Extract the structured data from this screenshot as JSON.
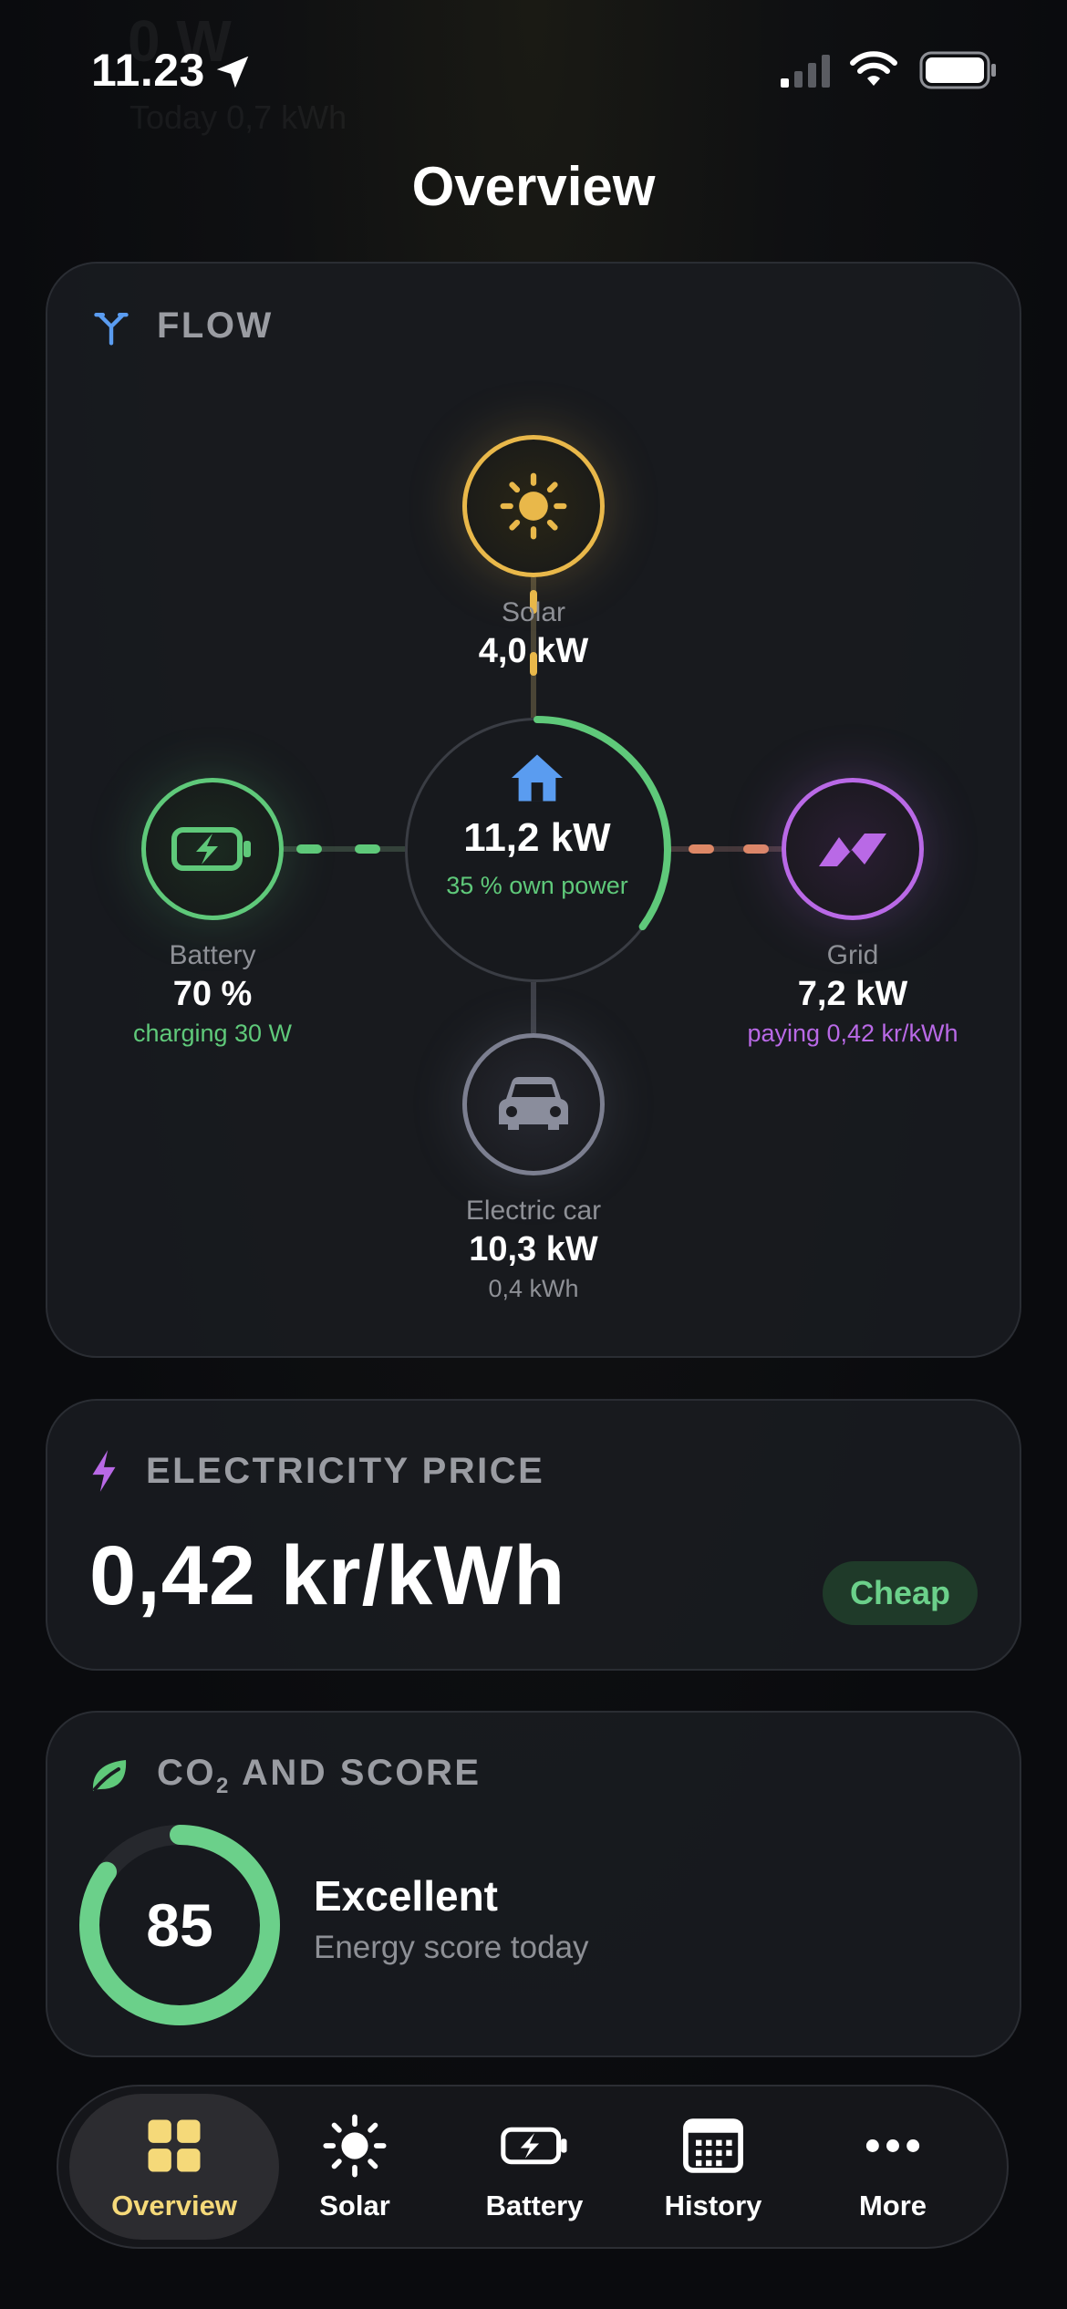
{
  "status_bar": {
    "time": "11.23",
    "ghost_power": "0 W",
    "ghost_today": "Today 0,7 kWh"
  },
  "page": {
    "title": "Overview"
  },
  "flow": {
    "header": "FLOW",
    "solar": {
      "name": "Solar",
      "value": "4,0 kW"
    },
    "home": {
      "value": "11,2 kW",
      "own_power": "35 % own power",
      "own_power_fraction": 0.35
    },
    "battery": {
      "name": "Battery",
      "value": "70 %",
      "sub": "charging 30 W"
    },
    "grid": {
      "name": "Grid",
      "value": "7,2 kW",
      "sub": "paying 0,42 kr/kWh"
    },
    "car": {
      "name": "Electric car",
      "value": "10,3 kW",
      "sub": "0,4 kWh"
    }
  },
  "price": {
    "header": "ELECTRICITY PRICE",
    "value": "0,42 kr/kWh",
    "badge": "Cheap"
  },
  "co2": {
    "header_prefix": "CO",
    "header_sub": "2",
    "header_suffix": " AND SCORE",
    "score": "85",
    "score_fraction": 0.85,
    "rating": "Excellent",
    "subtitle": "Energy score today"
  },
  "tabs": [
    {
      "label": "Overview",
      "icon": "grid-icon"
    },
    {
      "label": "Solar",
      "icon": "sun-icon"
    },
    {
      "label": "Battery",
      "icon": "battery-icon"
    },
    {
      "label": "History",
      "icon": "calendar-icon"
    },
    {
      "label": "More",
      "icon": "more-icon"
    }
  ],
  "colors": {
    "solar": "#e9b84a",
    "battery": "#5fc97a",
    "grid": "#b969e6",
    "car": "#7c7f90",
    "home_icon": "#5a9cf0",
    "accent_active": "#f5d979"
  }
}
